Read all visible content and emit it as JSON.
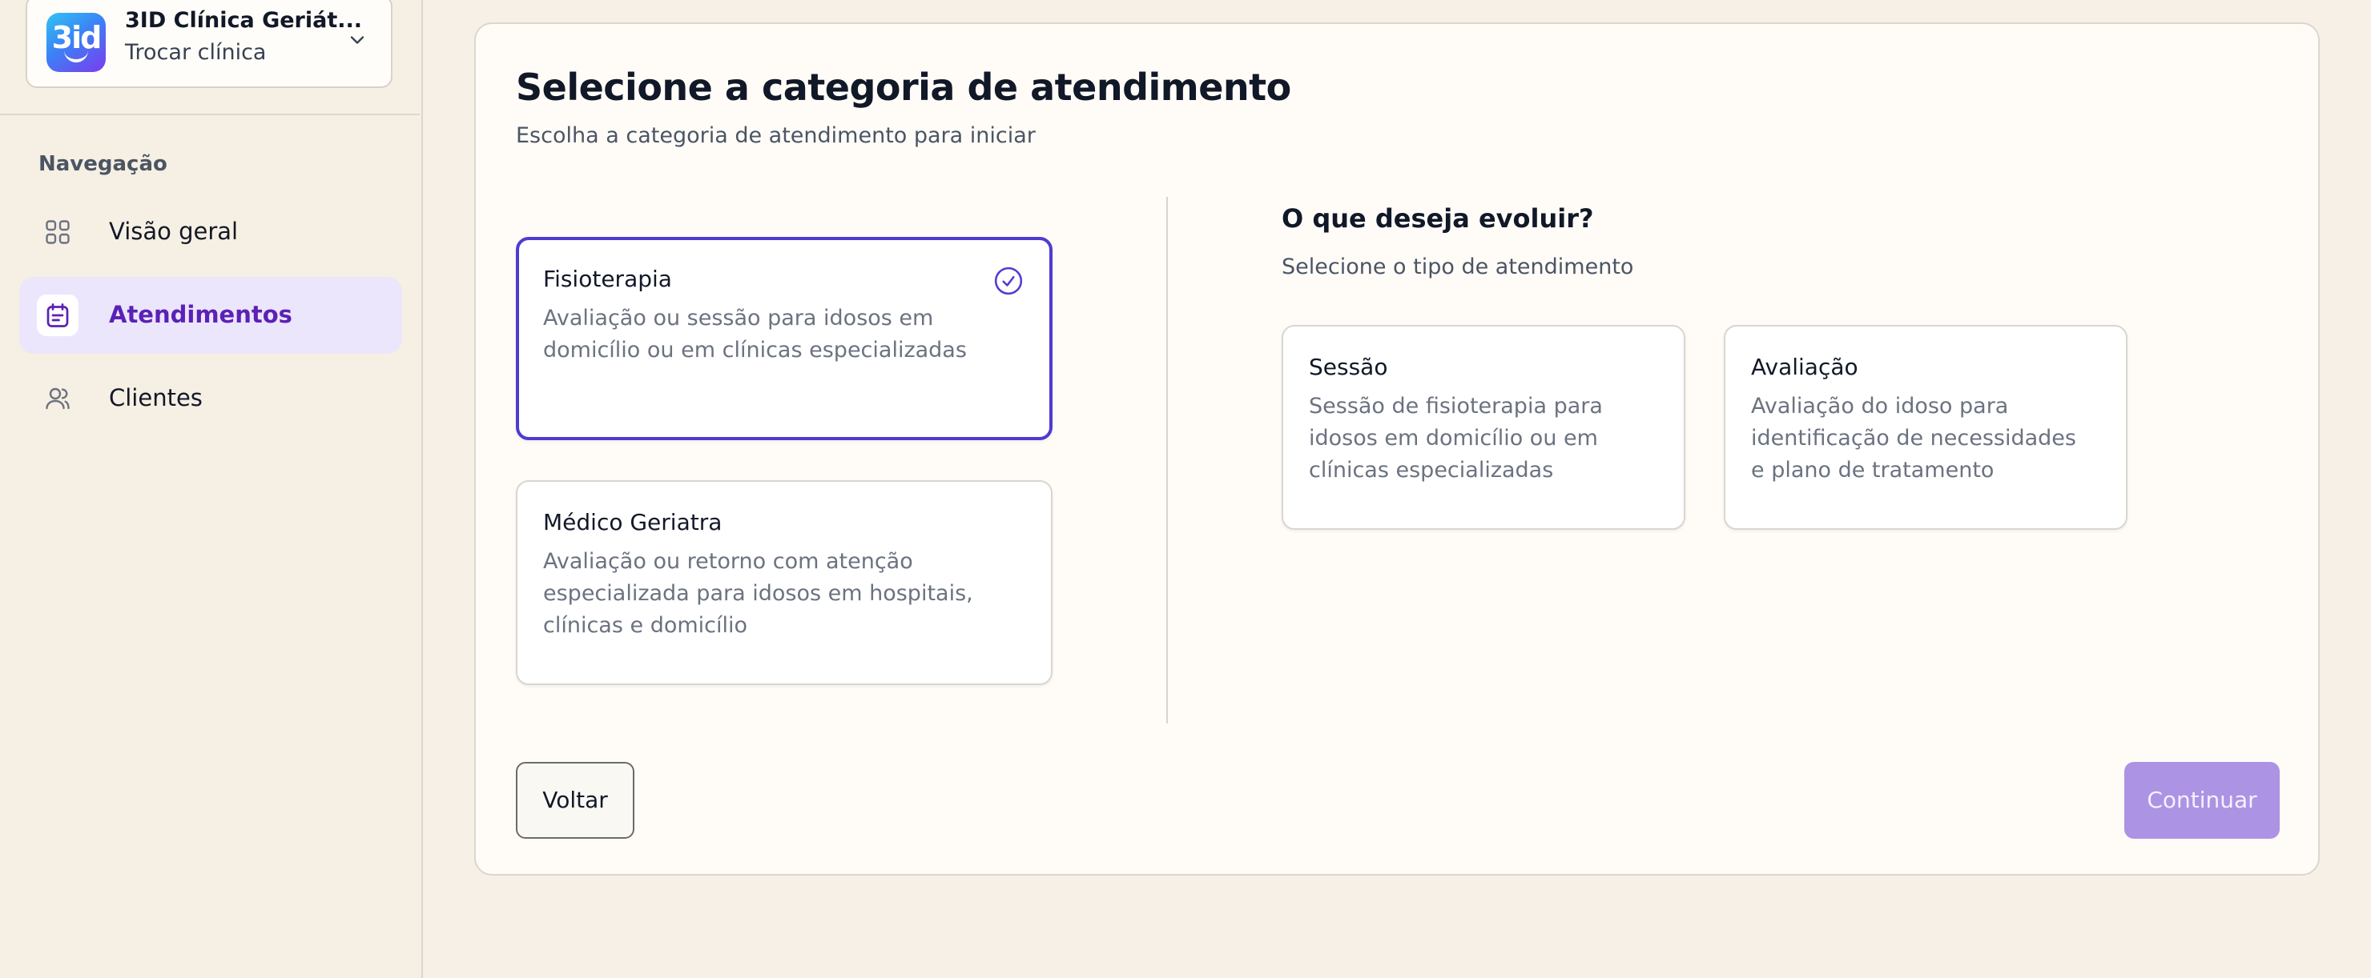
{
  "sidebar": {
    "clinic": {
      "logo_text": "3id",
      "name": "3ID Clínica Geriát...",
      "switch_label": "Trocar clínica"
    },
    "nav_heading": "Navegação",
    "items": [
      {
        "label": "Visão geral",
        "icon": "grid-icon",
        "active": false
      },
      {
        "label": "Atendimentos",
        "icon": "calendar-icon",
        "active": true
      },
      {
        "label": "Clientes",
        "icon": "users-icon",
        "active": false
      }
    ]
  },
  "main": {
    "title": "Selecione a categoria de atendimento",
    "subtitle": "Escolha a categoria de atendimento para iniciar",
    "categories": [
      {
        "title": "Fisioterapia",
        "description_lines": [
          "Avaliação ou sessão para idosos em",
          "domicílio ou em clínicas especializadas"
        ],
        "selected": true
      },
      {
        "title": "Médico Geriatra",
        "description_lines": [
          "Avaliação ou retorno com atenção",
          "especializada para idosos em hospitais,",
          "clínicas e domicílio"
        ],
        "selected": false
      }
    ],
    "evolve": {
      "title": "O que deseja evoluir?",
      "subtitle": "Selecione o tipo de atendimento",
      "types": [
        {
          "title": "Sessão",
          "description_lines": [
            "Sessão de fisioterapia para",
            "idosos em domicílio ou em",
            "clínicas especializadas"
          ]
        },
        {
          "title": "Avaliação",
          "description_lines": [
            "Avaliação do idoso para",
            "identificação de necessidades",
            "e plano de tratamento"
          ]
        }
      ]
    },
    "back_label": "Voltar",
    "continue_label": "Continuar"
  },
  "colors": {
    "accent": "#4f3bd1",
    "active_nav_bg": "#ebe6fb",
    "active_nav_text": "#5b21b6",
    "continue_disabled": "#ac93e3",
    "page_bg": "#f6f0e6"
  }
}
